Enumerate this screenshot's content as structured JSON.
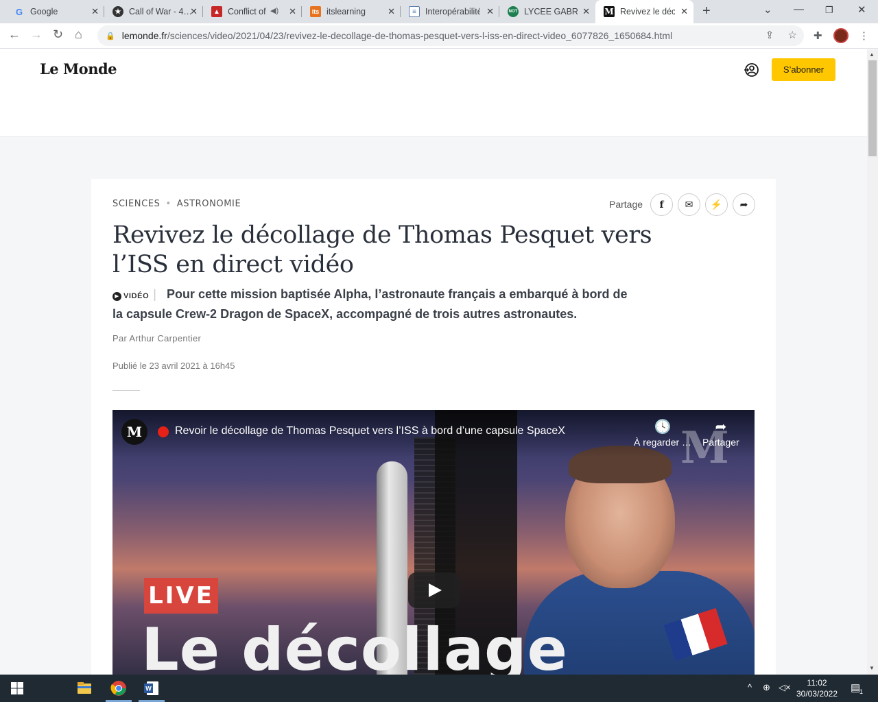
{
  "browser": {
    "tabs": [
      {
        "title": "Google",
        "icon": "google-icon",
        "color": "#4285f4"
      },
      {
        "title": "Call of War - 4…",
        "icon": "star-icon",
        "color": "#333333"
      },
      {
        "title": "Conflict of",
        "icon": "game-icon",
        "color": "#c62828"
      },
      {
        "title": "itslearning",
        "icon": "its-icon",
        "color": "#e8731f"
      },
      {
        "title": "Interopérabilité",
        "icon": "doc-icon",
        "color": "#5b7db1"
      },
      {
        "title": "LYCEE GABRIEL",
        "icon": "not-icon",
        "color": "#1e7f4f"
      },
      {
        "title": "Revivez le déc",
        "icon": "lemonde-icon",
        "color": "#111111"
      }
    ],
    "url_host": "lemonde.fr",
    "url_path": "/sciences/video/2021/04/23/revivez-le-decollage-de-thomas-pesquet-vers-l-iss-en-direct-video_6077826_1650684.html"
  },
  "site": {
    "logo": "Le Monde",
    "subscribe_label": "S’abonner"
  },
  "article": {
    "rubric": "SCIENCES",
    "subrubric": "ASTRONOMIE",
    "share_label": "Partage",
    "title": "Revivez le décollage de Thomas Pesquet vers l’ISS en direct vidéo",
    "badge": "VIDÉO",
    "description": "Pour cette mission baptisée Alpha, l’astronaute français a embarqué à bord de la capsule Crew-2 Dragon de SpaceX, accompagné de trois autres astronautes.",
    "author": "Par Arthur Carpentier",
    "date": "Publié le 23 avril 2021 à 16h45"
  },
  "video": {
    "channel_logo": "M",
    "title": "Revoir le décollage de Thomas Pesquet vers l’ISS à bord d’une capsule SpaceX",
    "watch_later": "À regarder …",
    "share": "Partager",
    "live_badge": "LIVE",
    "overlay_text": "Le décollage",
    "watermark": "M"
  },
  "taskbar": {
    "time": "11:02",
    "date": "30/03/2022",
    "notifications": "1"
  }
}
